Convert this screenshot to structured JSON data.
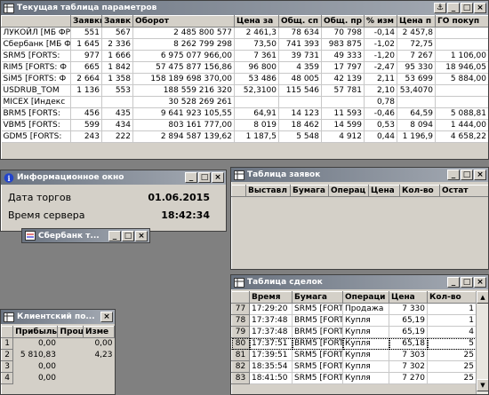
{
  "params": {
    "title": "Текущая таблица параметров",
    "columns": [
      "",
      "Заявки",
      "Заявк",
      "Оборот",
      "Цена за",
      "Общ. сп",
      "Общ. пр",
      "% изм",
      "Цена п",
      "ГО покуп"
    ],
    "rows": [
      [
        "ЛУКОЙЛ [МБ ФР",
        "551",
        "567",
        "2 485 800 577",
        "2 461,3",
        "78 634",
        "70 798",
        "-0,14",
        "2 457,8",
        ""
      ],
      [
        "Сбербанк [МБ ФР",
        "1 645",
        "2 336",
        "8 262 799 298",
        "73,50",
        "741 393",
        "983 875",
        "-1,02",
        "72,75",
        ""
      ],
      [
        "SRM5 [FORTS:",
        "977",
        "1 666",
        "6 975 077 966,00",
        "7 361",
        "39 731",
        "49 333",
        "-1,20",
        "7 267",
        "1 106,00"
      ],
      [
        "RIM5 [FORTS: Ф",
        "665",
        "1 842",
        "57 475 877 156,86",
        "96 800",
        "4 359",
        "17 797",
        "-2,47",
        "95 330",
        "18 946,05"
      ],
      [
        "SiM5 [FORTS: Ф",
        "2 664",
        "1 358",
        "158 189 698 370,00",
        "53 486",
        "48 005",
        "42 139",
        "2,11",
        "53 699",
        "5 884,00"
      ],
      [
        "USDRUB_TOM",
        "1 136",
        "553",
        "188 559 216 320",
        "52,3100",
        "115 546",
        "57 781",
        "2,10",
        "53,4070",
        ""
      ],
      [
        "MICEX [Индекс",
        "",
        "",
        "30 528 269 261",
        "",
        "",
        "",
        "0,78",
        "",
        ""
      ],
      [
        "BRM5 [FORTS:",
        "456",
        "435",
        "9 641 923 105,55",
        "64,91",
        "14 123",
        "11 593",
        "-0,46",
        "64,59",
        "5 088,81"
      ],
      [
        "VBM5 [FORTS:",
        "599",
        "434",
        "803 161 777,00",
        "8 019",
        "18 462",
        "14 599",
        "0,53",
        "8 094",
        "1 444,00"
      ],
      [
        "GDM5 [FORTS:",
        "243",
        "222",
        "2 894 587 139,62",
        "1 187,5",
        "5 548",
        "4 912",
        "0,44",
        "1 196,9",
        "4 658,22"
      ]
    ]
  },
  "info": {
    "title": "Информационное окно",
    "date_label": "Дата торгов",
    "date_value": "01.06.2015",
    "time_label": "Время сервера",
    "time_value": "18:42:34"
  },
  "sber": {
    "title": "Сбербанк т..."
  },
  "orders": {
    "title": "Таблица заявок",
    "columns": [
      "",
      "Выставл",
      "Бумага",
      "Операц",
      "Цена",
      "Кол-во",
      "Остат"
    ]
  },
  "deals": {
    "title": "Таблица сделок",
    "columns": [
      "",
      "Время",
      "Бумага",
      "Операци",
      "Цена",
      "Кол-во"
    ],
    "rows": [
      [
        "77",
        "17:29:20",
        "SRM5 [FORT",
        "Продажа",
        "7 330",
        "1"
      ],
      [
        "78",
        "17:37:48",
        "BRM5 [FORT",
        "Купля",
        "65,19",
        "1"
      ],
      [
        "79",
        "17:37:48",
        "BRM5 [FORT",
        "Купля",
        "65,19",
        "4"
      ],
      [
        "80",
        "17:37:51",
        "BRM5 [FORT",
        "Купля",
        "65,18",
        "5"
      ],
      [
        "81",
        "17:39:51",
        "SRM5 [FORT",
        "Купля",
        "7 303",
        "25"
      ],
      [
        "82",
        "18:35:54",
        "SRM5 [FORT",
        "Купля",
        "7 302",
        "25"
      ],
      [
        "83",
        "18:41:50",
        "SRM5 [FORT",
        "Купля",
        "7 270",
        "25"
      ]
    ]
  },
  "client": {
    "title": "Клиентский по...",
    "columns": [
      "",
      "Прибыль",
      "Проц",
      "Изме"
    ],
    "rows": [
      [
        "1",
        "0,00",
        "",
        "0,00"
      ],
      [
        "2",
        "5 810,83",
        "",
        "4,23"
      ],
      [
        "3",
        "0,00",
        "",
        ""
      ],
      [
        "4",
        "0,00",
        "",
        ""
      ]
    ]
  },
  "colors": {
    "titlebar": "#6a7380",
    "window": "#d4d0c8",
    "desktop": "#808080"
  }
}
